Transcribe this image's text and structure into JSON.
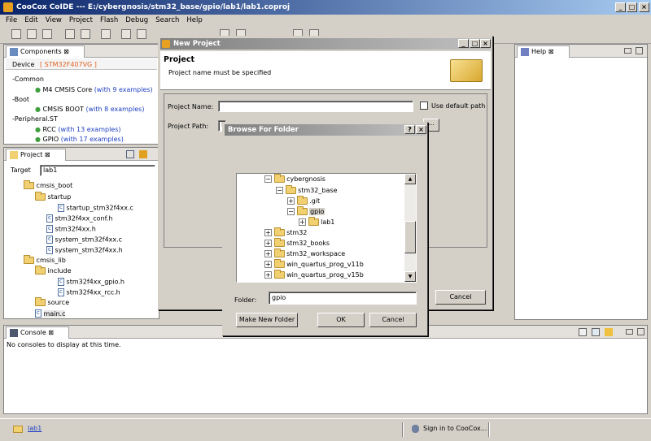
{
  "window": {
    "title": "CooCox CoIDE --- E:/cybergnosis/stm32_base/gpio/lab1/lab1.coproj"
  },
  "menu": [
    "File",
    "Edit",
    "View",
    "Project",
    "Flash",
    "Debug",
    "Search",
    "Help"
  ],
  "components": {
    "tab": "Components",
    "device_label": "Device",
    "device_value": "[ STM32F407VG ]",
    "items": [
      {
        "label": "Common"
      },
      {
        "label": "M4 CMSIS Core",
        "extra": "(with 9 examples)"
      },
      {
        "label": "Boot"
      },
      {
        "label": "CMSIS BOOT",
        "extra": "(with 8 examples)"
      },
      {
        "label": "Peripheral.ST"
      },
      {
        "label": "RCC",
        "extra": "(with 13 examples)"
      },
      {
        "label": "GPIO",
        "extra": "(with 17 examples)"
      }
    ]
  },
  "project": {
    "tab": "Project",
    "target_label": "Target",
    "target_value": "lab1",
    "items": [
      "cmsis_boot",
      "startup",
      "startup_stm32f4xx.c",
      "stm32f4xx_conf.h",
      "stm32f4xx.h",
      "system_stm32f4xx.c",
      "system_stm32f4xx.h",
      "cmsis_lib",
      "include",
      "stm32f4xx_gpio.h",
      "stm32f4xx_rcc.h",
      "source",
      "main.c"
    ]
  },
  "help": {
    "tab": "Help"
  },
  "console": {
    "tab": "Console",
    "message": "No consoles to display at this time."
  },
  "status": {
    "project_link": "lab1",
    "signin": "Sign in to CooCox..."
  },
  "new_project": {
    "title": "New Project",
    "heading": "Project",
    "message": "Project name must be specified",
    "name_label": "Project Name:",
    "name_value": "",
    "use_default": "Use default path",
    "path_label": "Project Path:",
    "path_value": "E",
    "cancel": "Cancel"
  },
  "browse": {
    "title": "Browse For Folder",
    "tree": [
      "cybergnosis",
      "stm32_base",
      ".git",
      "gpio",
      "lab1",
      "stm32",
      "stm32_books",
      "stm32_workspace",
      "win_quartus_prog_v11b",
      "win_quartus_prog_v15b"
    ],
    "folder_label": "Folder:",
    "folder_value": "gpio",
    "make_new": "Make New Folder",
    "ok": "OK",
    "cancel": "Cancel"
  }
}
